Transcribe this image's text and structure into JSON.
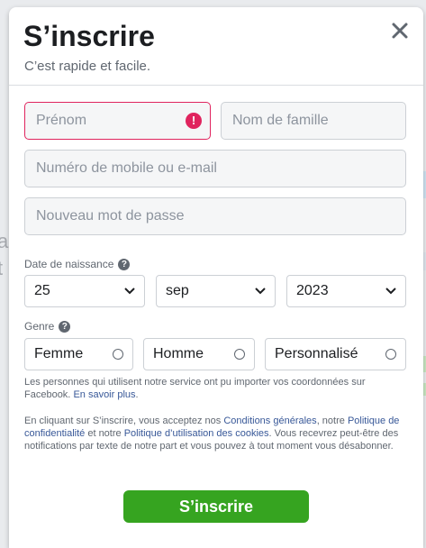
{
  "modal": {
    "title": "S’inscrire",
    "subtitle": "C’est rapide et facile."
  },
  "form": {
    "first_name_placeholder": "Prénom",
    "last_name_placeholder": "Nom de famille",
    "contact_placeholder": "Numéro de mobile ou e-mail",
    "password_placeholder": "Nouveau mot de passe",
    "error_symbol": "!",
    "birthday_label": "Date de naissance",
    "help_symbol": "?",
    "day": "25",
    "month": "sep",
    "year": "2023",
    "gender_label": "Genre",
    "gender_options": [
      "Femme",
      "Homme",
      "Personnalisé"
    ]
  },
  "notice": {
    "line1_text": "Les personnes qui utilisent notre service ont pu importer vos coordonnées sur Facebook.",
    "learn_more": "En savoir plus",
    "learn_more_end": ".",
    "terms_prefix": "En cliquant sur S’inscrire, vous acceptez nos ",
    "terms_link": "Conditions générales",
    "terms_mid1": ", notre ",
    "privacy_link": "Politique de confidentialité",
    "terms_mid2": " et notre ",
    "cookies_link": "Politique d’utilisation des cookies",
    "terms_suffix": ". Vous recevrez peut-être des notifications par texte de notre part et vous pouvez à tout moment vous désabonner."
  },
  "submit_label": "S’inscrire",
  "background": {
    "ghost_a": "a",
    "ghost_t": "t"
  },
  "colors": {
    "error": "#e0245e",
    "submit": "#36a420",
    "link": "#385898"
  }
}
